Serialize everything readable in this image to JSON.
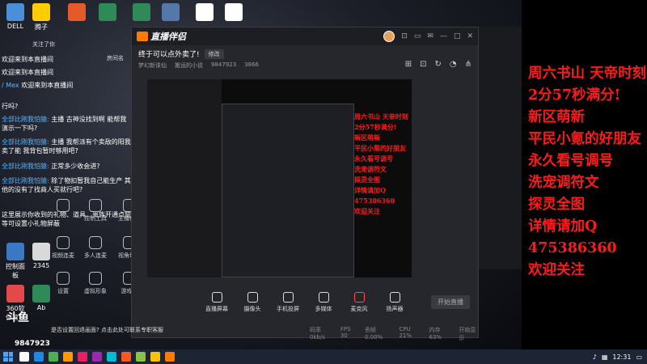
{
  "desktop": {
    "icons": [
      {
        "label": "DELL",
        "color": "#4a90d9"
      },
      {
        "label": "腾子",
        "color": "#ffcc00"
      },
      {
        "label": "",
        "color": "#e55a2b"
      },
      {
        "label": "",
        "color": "#2e8b57"
      },
      {
        "label": "",
        "color": "#2e8b57"
      },
      {
        "label": "",
        "color": "#5577aa"
      },
      {
        "label": "",
        "color": "#ffffff"
      },
      {
        "label": "",
        "color": "#ffffff"
      }
    ],
    "left_labels": [
      "控制面板",
      "2345",
      "360软件管家",
      "Ab"
    ]
  },
  "chat": {
    "tab_label": "关注了你",
    "tab_right": "房间名",
    "messages": [
      {
        "badge": "",
        "name": "",
        "text": "欢迎来到本直播间"
      },
      {
        "badge": "",
        "name": "",
        "text": "欢迎来到本直播间"
      },
      {
        "badge": "",
        "name": "/ Mex",
        "text": "欢迎来到本直播间"
      },
      {
        "badge": "",
        "name": "",
        "text": "行吗?"
      },
      {
        "badge": "",
        "name": "全部比刚我怕猿:",
        "text": "主播 古神没找到啊 能帮我演示一下吗?"
      },
      {
        "badge": "",
        "name": "全部比刚我怕猿:",
        "text": "主播 我帮派有个卖敌的阳我卖了能 我背包暂时够用吧?"
      },
      {
        "badge": "",
        "name": "全部比刚我怕猿:",
        "text": "正常多少收会进?"
      },
      {
        "badge": "",
        "name": "全部比刚我怕猿:",
        "text": "除了物扣暂我自己能生产 其他的没有了找商人买就行吧?"
      },
      {
        "badge": "",
        "name": "",
        "text": "这里展示你收到的礼物、道具、贵族开通点赞等可设置小礼物屏蔽"
      }
    ],
    "tools": [
      {
        "label": "",
        "x": 0
      },
      {
        "label": "控制工具",
        "x": 1
      },
      {
        "label": "主播任务",
        "x": 2
      },
      {
        "label": "视频连麦",
        "x": 0
      },
      {
        "label": "多人连麦",
        "x": 1
      },
      {
        "label": "视角切换",
        "x": 2
      },
      {
        "label": "设置",
        "x": 0
      },
      {
        "label": "虚拟形象",
        "x": 1
      },
      {
        "label": "游戏秀",
        "x": 2
      }
    ]
  },
  "window": {
    "app_name": "直播伴侣",
    "room_title": "终于可以点外卖了!",
    "edit_label": "修改",
    "meta": [
      "梦幻新诛仙",
      "搬运的小说",
      "9847923",
      "3866"
    ],
    "controls": [
      "⊡",
      "▭",
      "✉",
      "—",
      "□",
      "✕"
    ],
    "bottom_tools": [
      {
        "label": "直播屏幕",
        "type": "normal"
      },
      {
        "label": "摄像头",
        "type": "normal"
      },
      {
        "label": "手机投屏",
        "type": "normal"
      },
      {
        "label": "多媒体",
        "type": "normal"
      },
      {
        "label": "麦克风",
        "type": "mic"
      },
      {
        "label": "扬声器",
        "type": "normal"
      }
    ],
    "start_label": "开始直播",
    "notice": "是否设置回退画面? 点击此处可联系专职客服",
    "status": [
      "码率0kb/s",
      "FPS 30",
      "丢帧 0.00%",
      "CPU 21%",
      "内存 63%",
      "开始显示"
    ]
  },
  "preview": {
    "red_lines": [
      "周六书山 天帝时刻",
      "2分57秒满分!",
      "新区萌新",
      "平民小氪的好朋友",
      "永久看号调号",
      "洗宠调符文",
      "探灵全图",
      "详情请加Q",
      "475386360",
      "欢迎关注"
    ]
  },
  "right_panel": {
    "lines": [
      "周六书山 天帝时刻",
      "2分57秒满分!",
      "新区萌新",
      "平民小氪的好朋友",
      "永久看号调号",
      "洗宠调符文",
      "探灵全图",
      "详情请加Q",
      "475386360",
      "欢迎关注"
    ]
  },
  "overlay": {
    "brand": "斗鱼",
    "room_id": "9847923"
  },
  "taskbar": {
    "time": "12:31"
  },
  "colors": {
    "accent": "#ff7a00",
    "red_text": "#ff1a1a"
  }
}
